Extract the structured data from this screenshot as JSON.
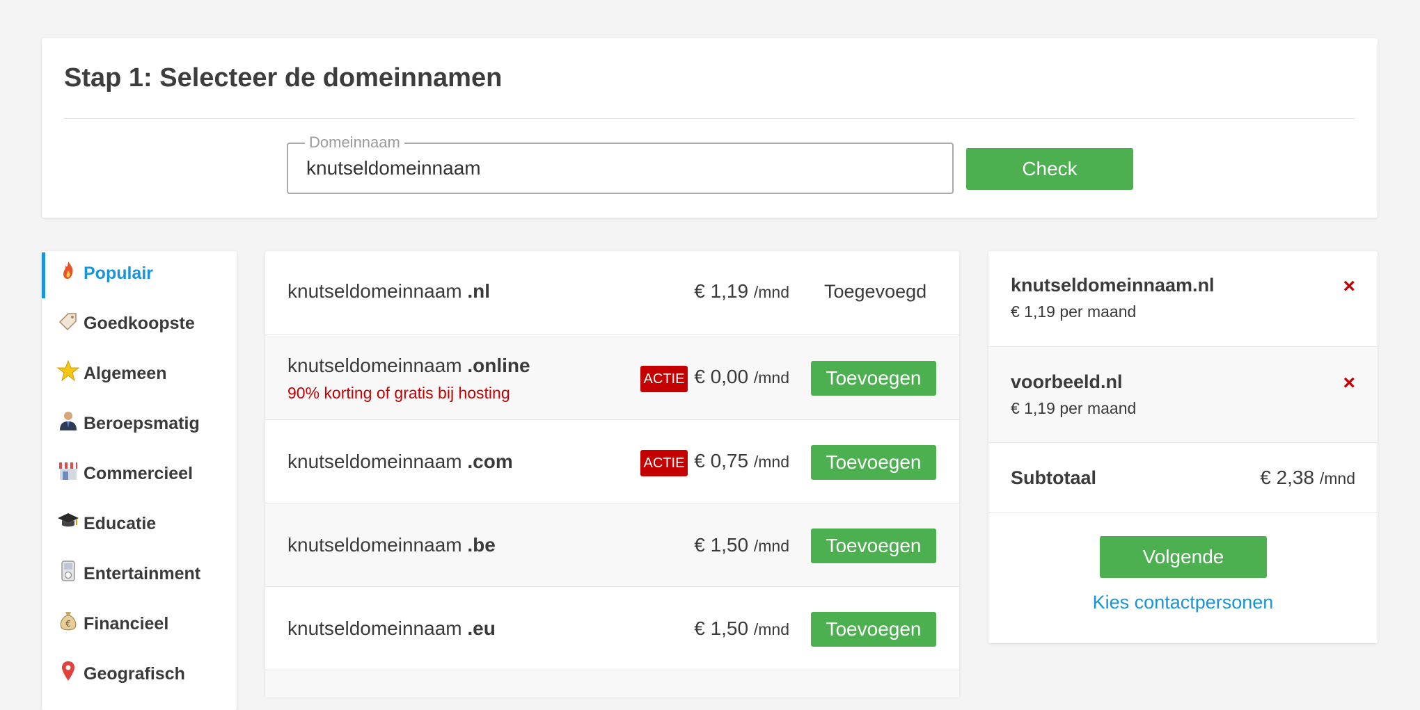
{
  "step": {
    "title": "Stap 1: Selecteer de domeinnamen",
    "field_label": "Domeinnaam",
    "field_value": "knutseldomeinnaam",
    "check_label": "Check"
  },
  "sidebar": {
    "items": [
      {
        "label": "Populair",
        "icon": "flame-icon",
        "active": true
      },
      {
        "label": "Goedkoopste",
        "icon": "price-tag-icon",
        "active": false
      },
      {
        "label": "Algemeen",
        "icon": "star-icon",
        "active": false
      },
      {
        "label": "Beroepsmatig",
        "icon": "businessman-icon",
        "active": false
      },
      {
        "label": "Commercieel",
        "icon": "storefront-icon",
        "active": false
      },
      {
        "label": "Educatie",
        "icon": "graduation-cap-icon",
        "active": false
      },
      {
        "label": "Entertainment",
        "icon": "media-player-icon",
        "active": false
      },
      {
        "label": "Financieel",
        "icon": "money-bag-icon",
        "active": false
      },
      {
        "label": "Geografisch",
        "icon": "map-pin-icon",
        "active": false
      }
    ]
  },
  "domains": {
    "price_unit": "/mnd",
    "promo_badge": "ACTIE",
    "add_label": "Toevoegen",
    "added_label": "Toegevoegd",
    "rows": [
      {
        "base": "knutseldomeinnaam",
        "tld": ".nl",
        "price": "€ 1,19",
        "promo": "",
        "actie": false,
        "added": true
      },
      {
        "base": "knutseldomeinnaam",
        "tld": ".online",
        "price": "€ 0,00",
        "promo": "90% korting of gratis bij hosting",
        "actie": true,
        "added": false
      },
      {
        "base": "knutseldomeinnaam",
        "tld": ".com",
        "price": "€ 0,75",
        "promo": "",
        "actie": true,
        "added": false
      },
      {
        "base": "knutseldomeinnaam",
        "tld": ".be",
        "price": "€ 1,50",
        "promo": "",
        "actie": false,
        "added": false
      },
      {
        "base": "knutseldomeinnaam",
        "tld": ".eu",
        "price": "€ 1,50",
        "promo": "",
        "actie": false,
        "added": false
      }
    ]
  },
  "cart": {
    "items": [
      {
        "name": "knutseldomeinnaam.nl",
        "price": "€ 1,19 per maand"
      },
      {
        "name": "voorbeeld.nl",
        "price": "€ 1,19 per maand"
      }
    ],
    "remove_symbol": "×",
    "subtotal_label": "Subtotaal",
    "subtotal_value": "€ 2,38",
    "subtotal_unit": "/mnd",
    "next_label": "Volgende",
    "contacts_link": "Kies contactpersonen"
  },
  "colors": {
    "accent_green": "#4caf50",
    "link_blue": "#1a94d9",
    "promo_red": "#c40000"
  }
}
